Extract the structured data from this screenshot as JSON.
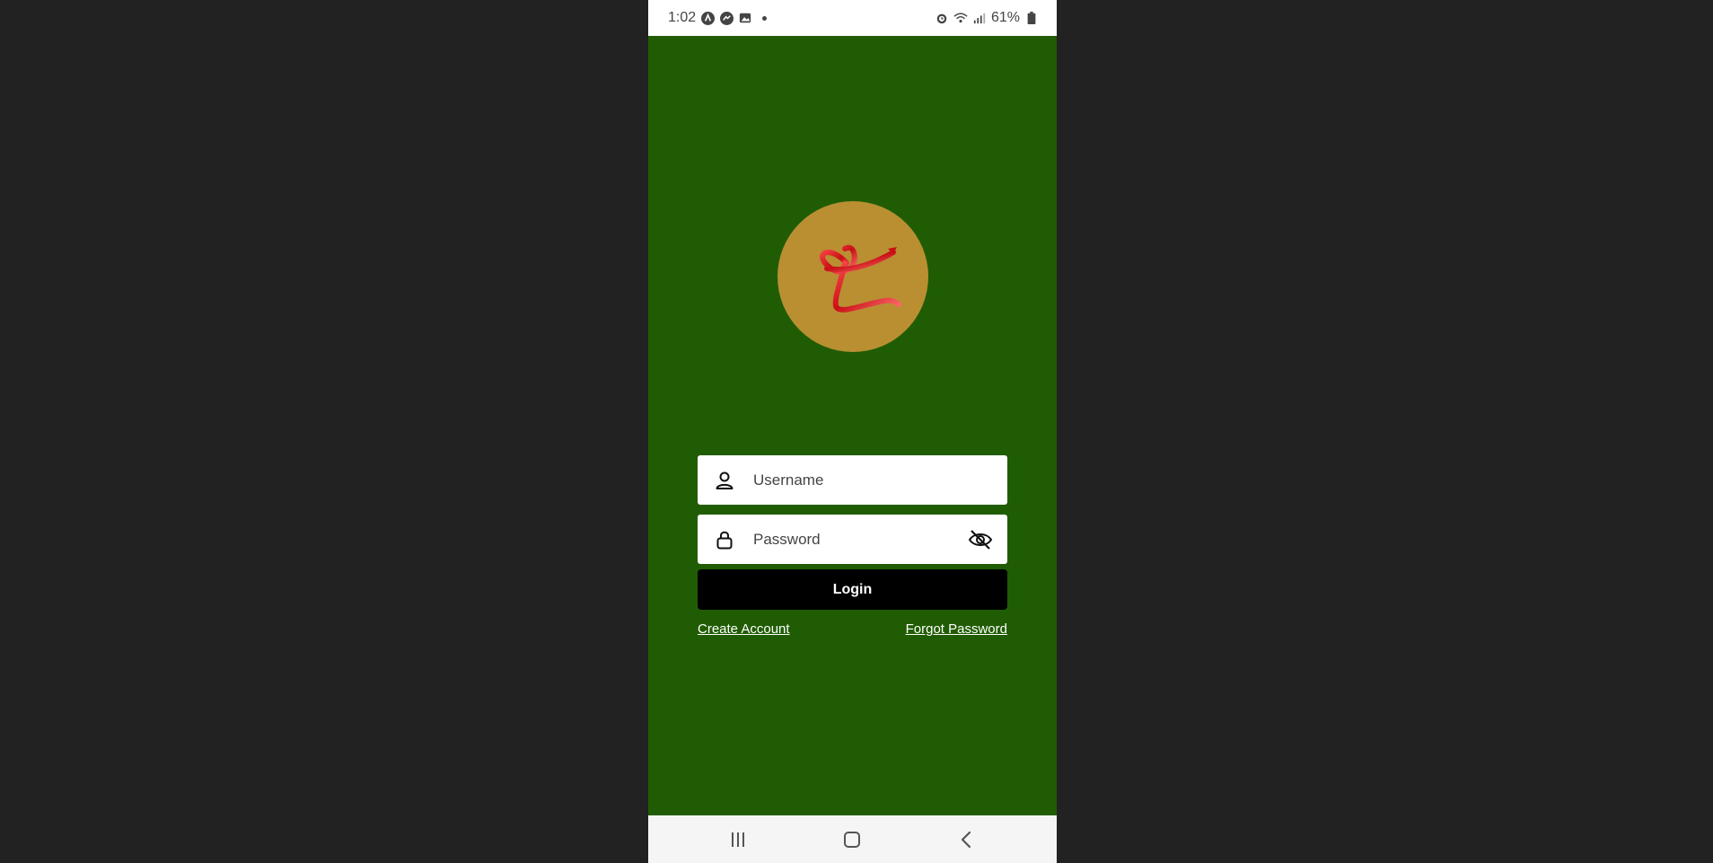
{
  "status_bar": {
    "time": "1:02",
    "battery": "61%",
    "left_icons": [
      "navigation-app-icon",
      "messenger-icon",
      "gallery-icon",
      "more-notifications-dot"
    ],
    "right_icons": [
      "alarm-icon",
      "wifi-icon",
      "signal-icon",
      "battery-icon"
    ]
  },
  "logo": {
    "icon": "ribbon-heart-logo",
    "background_color": "#b98f32",
    "ribbon_color": "#d8141c"
  },
  "form": {
    "username_placeholder": "Username",
    "password_placeholder": "Password",
    "username_icon": "user-icon",
    "password_icon": "lock-icon",
    "visibility_icon": "eye-off-icon",
    "login_label": "Login",
    "create_account_label": "Create Account",
    "forgot_password_label": "Forgot Password"
  },
  "nav_bar": {
    "buttons": [
      "recent-apps-icon",
      "home-icon",
      "back-icon"
    ]
  },
  "colors": {
    "app_background": "#205c03",
    "outer_background": "#222222",
    "login_button": "#000000"
  }
}
